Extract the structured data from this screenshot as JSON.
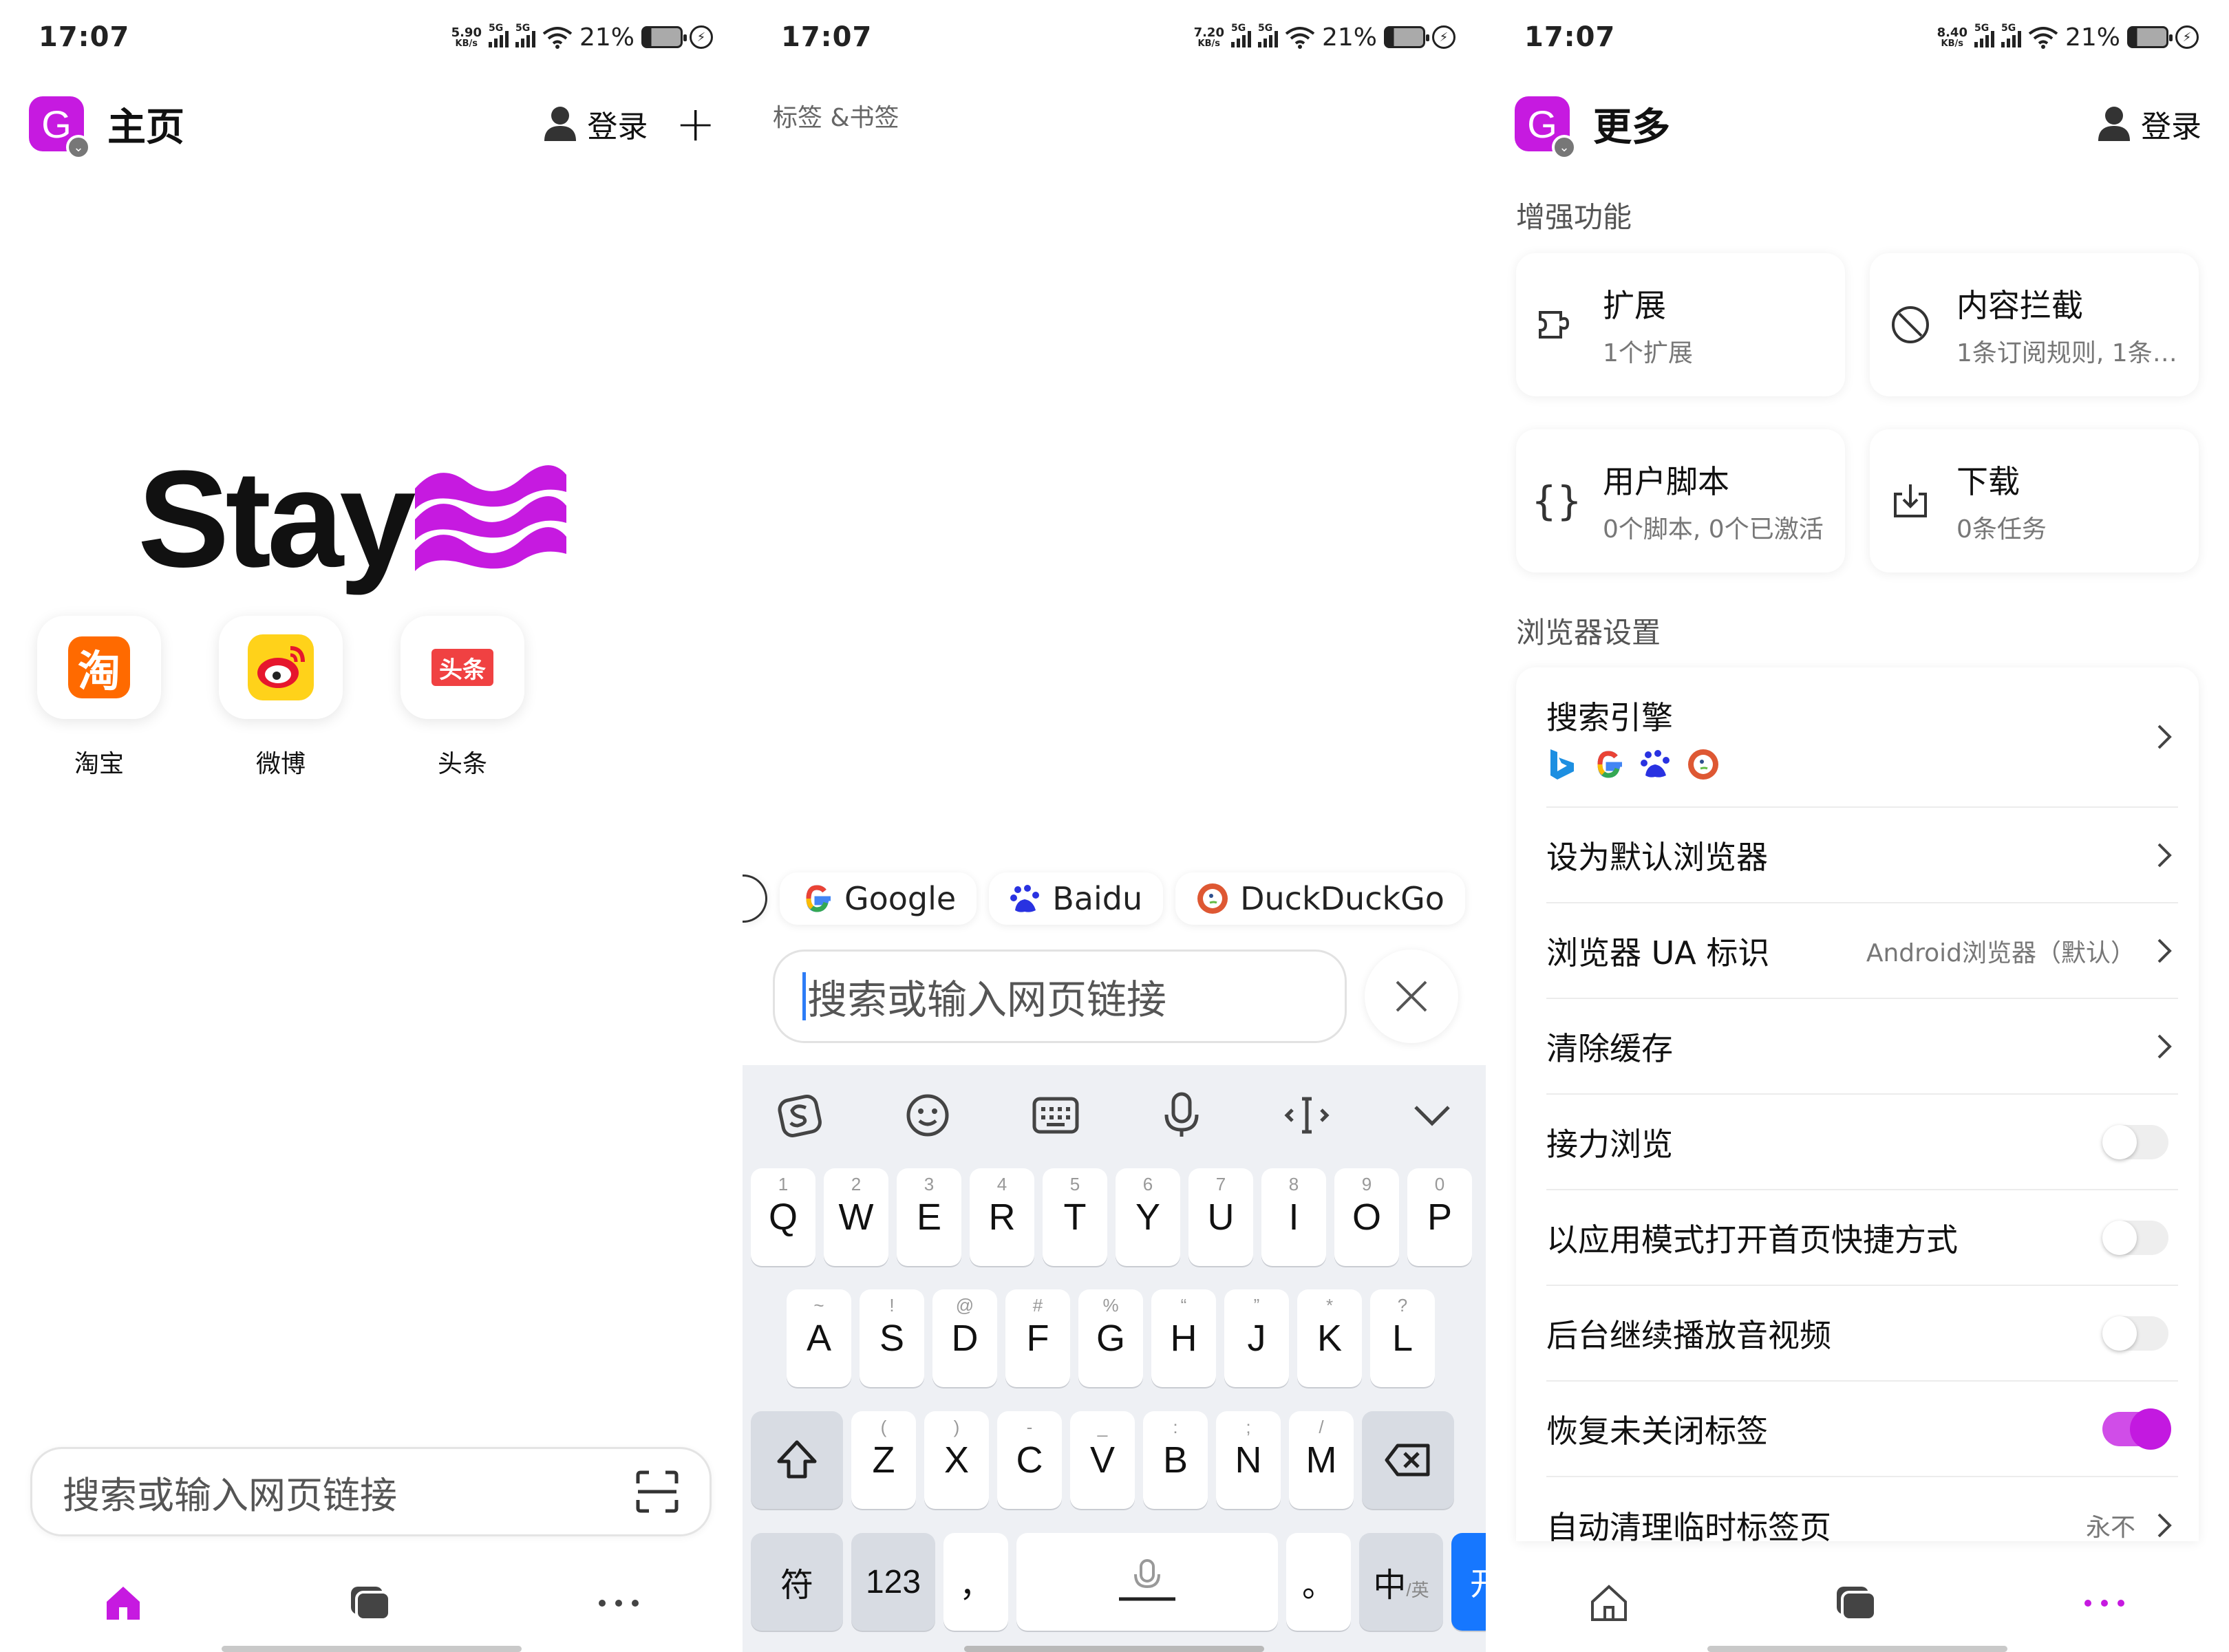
{
  "status": {
    "time": "17:07",
    "battery": "21%",
    "speed_p1": "5.90",
    "speed_p2": "7.20",
    "speed_p3": "8.40",
    "speed_unit": "KB/s",
    "net": "5G"
  },
  "home": {
    "logo_letter": "G",
    "title": "主页",
    "login": "登录",
    "brand_word": "Stay",
    "shortcuts": [
      {
        "label": "淘宝",
        "glyph": "淘",
        "color": "#ff6a00"
      },
      {
        "label": "微博",
        "glyph": "微",
        "color": "#e6162d"
      },
      {
        "label": "头条",
        "glyph": "头条",
        "color": "#f04142"
      }
    ],
    "search_placeholder": "搜索或输入网页链接"
  },
  "tabs": {
    "header": "标签 &书签",
    "engines": [
      "Google",
      "Baidu",
      "DuckDuckGo"
    ],
    "url_placeholder": "搜索或输入网页链接",
    "keyboard": {
      "row1": [
        [
          "Q",
          "1"
        ],
        [
          "W",
          "2"
        ],
        [
          "E",
          "3"
        ],
        [
          "R",
          "4"
        ],
        [
          "T",
          "5"
        ],
        [
          "Y",
          "6"
        ],
        [
          "U",
          "7"
        ],
        [
          "I",
          "8"
        ],
        [
          "O",
          "9"
        ],
        [
          "P",
          "0"
        ]
      ],
      "row2": [
        [
          "A",
          "~"
        ],
        [
          "S",
          "!"
        ],
        [
          "D",
          "@"
        ],
        [
          "F",
          "#"
        ],
        [
          "G",
          "%"
        ],
        [
          "H",
          "“"
        ],
        [
          "J",
          "”"
        ],
        [
          "K",
          "*"
        ],
        [
          "L",
          "?"
        ]
      ],
      "row3": [
        [
          "Z",
          "("
        ],
        [
          "X",
          ")"
        ],
        [
          "C",
          "-"
        ],
        [
          "V",
          "_"
        ],
        [
          "B",
          ":"
        ],
        [
          "N",
          ";"
        ],
        [
          "M",
          "/"
        ]
      ],
      "sym": "符",
      "num": "123",
      "comma": "，",
      "period": "。",
      "lang": "中",
      "lang_sub": "/英",
      "go": "开始"
    }
  },
  "more": {
    "logo_letter": "G",
    "title": "更多",
    "login": "登录",
    "section_enhance": "增强功能",
    "cards": [
      {
        "title": "扩展",
        "sub": "1个扩展",
        "icon": "extension-icon"
      },
      {
        "title": "内容拦截",
        "sub": "1条订阅规则, 1条…",
        "icon": "block-icon"
      },
      {
        "title": "用户脚本",
        "sub": "0个脚本, 0个已激活",
        "icon": "braces-icon"
      },
      {
        "title": "下载",
        "sub": "0条任务",
        "icon": "download-icon"
      }
    ],
    "section_browser": "浏览器设置",
    "settings": [
      {
        "label": "搜索引擎",
        "type": "engines"
      },
      {
        "label": "设为默认浏览器",
        "type": "link"
      },
      {
        "label": "浏览器 UA 标识",
        "type": "link",
        "value": "Android浏览器（默认）"
      },
      {
        "label": "清除缓存",
        "type": "link"
      },
      {
        "label": "接力浏览",
        "type": "toggle",
        "on": false
      },
      {
        "label": "以应用模式打开首页快捷方式",
        "type": "toggle",
        "on": false
      },
      {
        "label": "后台继续播放音视频",
        "type": "toggle",
        "on": false
      },
      {
        "label": "恢复未关闭标签",
        "type": "toggle",
        "on": true
      },
      {
        "label": "自动清理临时标签页",
        "type": "link",
        "value": "永不"
      }
    ]
  },
  "colors": {
    "accent": "#c61ae0",
    "key_blue": "#1677ff"
  }
}
